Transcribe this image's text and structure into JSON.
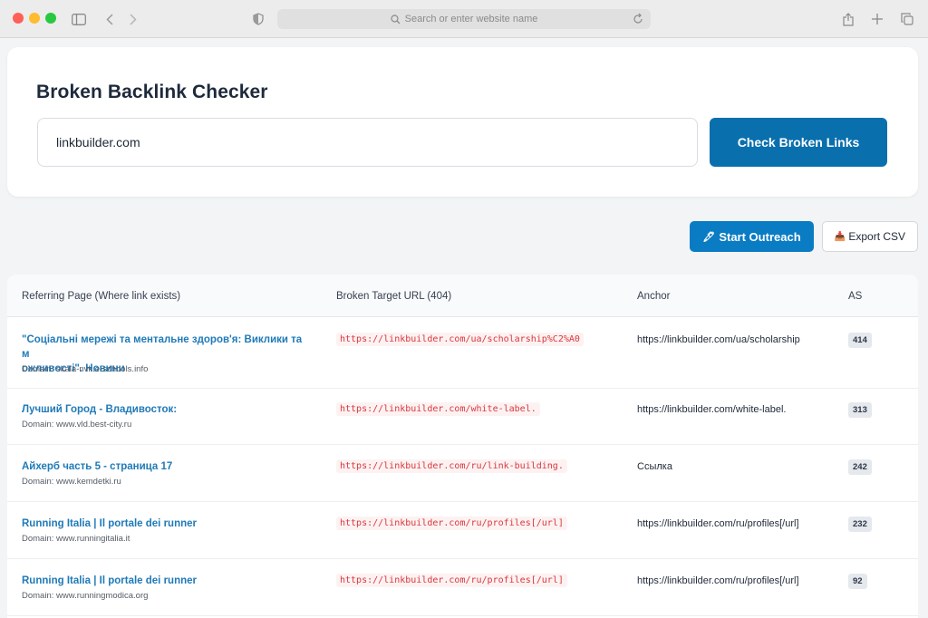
{
  "browser": {
    "url_placeholder": "Search or enter website name"
  },
  "checker": {
    "title": "Broken Backlink Checker",
    "domain_value": "linkbuilder.com",
    "check_label": "Check Broken Links"
  },
  "actions": {
    "outreach_icon": "🖋",
    "outreach_label": "Start Outreach",
    "export_icon": "📥",
    "export_label": "Export CSV"
  },
  "table": {
    "headers": {
      "referring": "Referring Page (Where link exists)",
      "broken": "Broken Target URL (404)",
      "anchor": "Anchor",
      "as": "AS"
    },
    "rows": [
      {
        "title_line1": "\"Соціальні мережі та ментальне здоров'я: Виклики та м",
        "title_line2": "ожливості\". Новини",
        "domain": "Domain: skala-nvk.e-schools.info",
        "broken_url": "https://linkbuilder.com/ua/scholarship%C2%A0",
        "anchor": "https://linkbuilder.com/ua/scholarship",
        "as": "414"
      },
      {
        "title_line1": "Лучший Город - Владивосток:",
        "domain": "Domain: www.vld.best-city.ru",
        "broken_url": "https://linkbuilder.com/white-label.",
        "anchor": "https://linkbuilder.com/white-label.",
        "as": "313"
      },
      {
        "title_line1": "Айхерб часть 5 - страница 17",
        "domain": "Domain: www.kemdetki.ru",
        "broken_url": "https://linkbuilder.com/ru/link-building.",
        "anchor": "Ссылка",
        "as": "242"
      },
      {
        "title_line1": "Running Italia | Il portale dei runner",
        "domain": "Domain: www.runningitalia.it",
        "broken_url": "https://linkbuilder.com/ru/profiles[/url]",
        "anchor": "https://linkbuilder.com/ru/profiles[/url]",
        "as": "232"
      },
      {
        "title_line1": "Running Italia | Il portale dei runner",
        "domain": "Domain: www.runningmodica.org",
        "broken_url": "https://linkbuilder.com/ru/profiles[/url]",
        "anchor": "https://linkbuilder.com/ru/profiles[/url]",
        "as": "92"
      }
    ]
  }
}
